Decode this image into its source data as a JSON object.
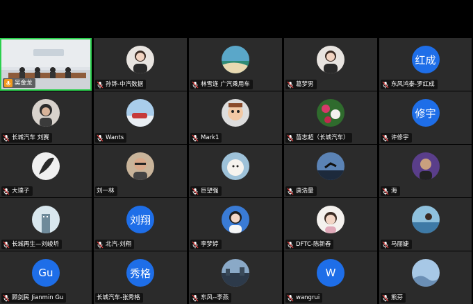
{
  "colors": {
    "active_border": "#2bd04e",
    "avatar_blue": "#1e6ee8",
    "tile_bg": "#2b2b2b"
  },
  "tiles": [
    {
      "name": "吴金龙",
      "type": "video",
      "speaking": true
    },
    {
      "name": "孙铧-中汽数据",
      "type": "photo",
      "muted": true,
      "photo": "woman-portrait"
    },
    {
      "name": "林雪连 广汽乘用车",
      "type": "photo",
      "muted": true,
      "photo": "beach"
    },
    {
      "name": "葛梦男",
      "type": "photo",
      "muted": true,
      "photo": "woman-portrait"
    },
    {
      "name": "东风鸿泰-罗红成",
      "type": "text",
      "initials": "红成",
      "muted": true
    },
    {
      "name": "长城汽车 刘赛",
      "type": "photo",
      "muted": true,
      "photo": "man-portrait"
    },
    {
      "name": "Wants",
      "type": "photo",
      "muted": true,
      "photo": "car-sky"
    },
    {
      "name": "Mark1",
      "type": "photo",
      "muted": true,
      "photo": "cartoon"
    },
    {
      "name": "苗志超（长城汽车）",
      "type": "photo",
      "muted": true,
      "photo": "flowers"
    },
    {
      "name": "许修宇",
      "type": "text",
      "initials": "修宇",
      "muted": true
    },
    {
      "name": "大璞子",
      "type": "photo",
      "muted": true,
      "photo": "feather"
    },
    {
      "name": "刘一林",
      "type": "photo",
      "muted": false,
      "photo": "man-glasses"
    },
    {
      "name": "巨望强",
      "type": "photo",
      "muted": true,
      "photo": "sheep"
    },
    {
      "name": "唐浩量",
      "type": "photo",
      "muted": true,
      "photo": "jump"
    },
    {
      "name": "海",
      "type": "photo",
      "muted": true,
      "photo": "man-purple"
    },
    {
      "name": "长城再生—刘峻圻",
      "type": "photo",
      "muted": true,
      "photo": "building"
    },
    {
      "name": "北汽-刘翔",
      "type": "text",
      "initials": "刘翔",
      "muted": true
    },
    {
      "name": "李梦婷",
      "type": "photo",
      "muted": true,
      "photo": "woman-blue"
    },
    {
      "name": "DFTC-陈新春",
      "type": "photo",
      "muted": true,
      "photo": "child"
    },
    {
      "name": "马丽婕",
      "type": "photo",
      "muted": true,
      "photo": "sea-woman"
    },
    {
      "name": "顾剑民 Jianmin Gu",
      "type": "text",
      "initials": "Gu",
      "muted": true
    },
    {
      "name": "长城汽车-张秀格",
      "type": "text",
      "initials": "秀格",
      "muted": false
    },
    {
      "name": "东风--李燕",
      "type": "photo",
      "muted": true,
      "photo": "city-night"
    },
    {
      "name": "wangrui",
      "type": "text",
      "initials": "W",
      "muted": true
    },
    {
      "name": "熊芬",
      "type": "photo",
      "muted": true,
      "photo": "sky-hills"
    }
  ]
}
